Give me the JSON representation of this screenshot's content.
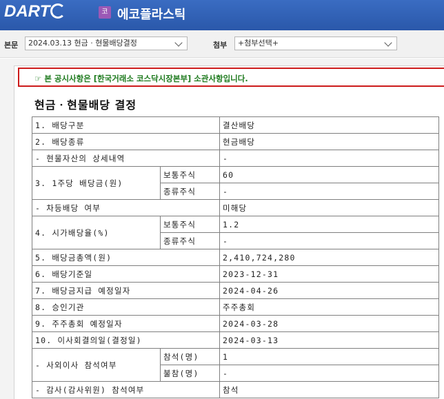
{
  "header": {
    "logo": "DART",
    "corp_badge": "코",
    "corp_name": "에코플라스틱"
  },
  "toolbar": {
    "body_label": "본문",
    "body_select_value": "2024.03.13  현금 · 현물배당결정",
    "attach_label": "첨부",
    "attach_select_value": "+첨부선택+"
  },
  "notice": {
    "text": "☞ 본 공시사항은 [한국거래소 코스닥시장본부] 소관사항입니다."
  },
  "document": {
    "title": "현금ㆍ현물배당 결정",
    "rows": {
      "r1_label": "1. 배당구분",
      "r1_value": "결산배당",
      "r2_label": "2. 배당종류",
      "r2_value": "현금배당",
      "r3_label": "- 현물자산의 상세내역",
      "r3_value": "-",
      "r4_label": "3. 1주당 배당금(원)",
      "r4a_sub": "보통주식",
      "r4a_value": "60",
      "r4b_sub": "종류주식",
      "r4b_value": "-",
      "r5_label": "- 차등배당 여부",
      "r5_value": "미해당",
      "r6_label": "4. 시가배당율(%)",
      "r6a_sub": "보통주식",
      "r6a_value": "1.2",
      "r6b_sub": "종류주식",
      "r6b_value": "-",
      "r7_label": "5. 배당금총액(원)",
      "r7_value": "2,410,724,280",
      "r8_label": "6. 배당기준일",
      "r8_value": "2023-12-31",
      "r9_label": "7. 배당금지급 예정일자",
      "r9_value": "2024-04-26",
      "r10_label": "8. 승인기관",
      "r10_value": "주주총회",
      "r11_label": "9. 주주총회 예정일자",
      "r11_value": "2024-03-28",
      "r12_label": "10. 이사회결의일(결정일)",
      "r12_value": "2024-03-13",
      "r13_label": "- 사외이사 참석여부",
      "r13a_sub": "참석(명)",
      "r13a_value": "1",
      "r13b_sub": "불참(명)",
      "r13b_value": "-",
      "r14_label": "- 감사(감사위원) 참석여부",
      "r14_value": "참석"
    }
  }
}
